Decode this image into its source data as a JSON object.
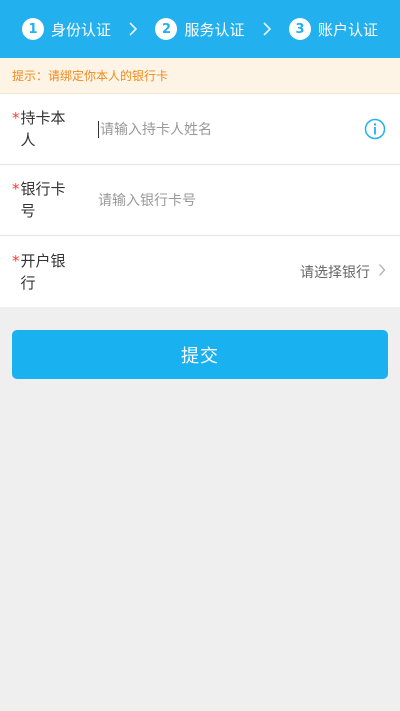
{
  "steps": [
    {
      "num": "1",
      "label": "身份认证"
    },
    {
      "num": "2",
      "label": "服务认证"
    },
    {
      "num": "3",
      "label": "账户认证"
    }
  ],
  "tip": "提示：请绑定你本人的银行卡",
  "form": {
    "required_mark": "*",
    "cardholder": {
      "label": "持卡本人",
      "placeholder": "请输入持卡人姓名"
    },
    "card_number": {
      "label": "银行卡号",
      "placeholder": "请输入银行卡号"
    },
    "bank": {
      "label": "开户银行",
      "value": "请选择银行"
    }
  },
  "submit_label": "提交",
  "colors": {
    "accent": "#23b0ef",
    "tip_text": "#f08a1c",
    "required": "#ff3b30"
  }
}
